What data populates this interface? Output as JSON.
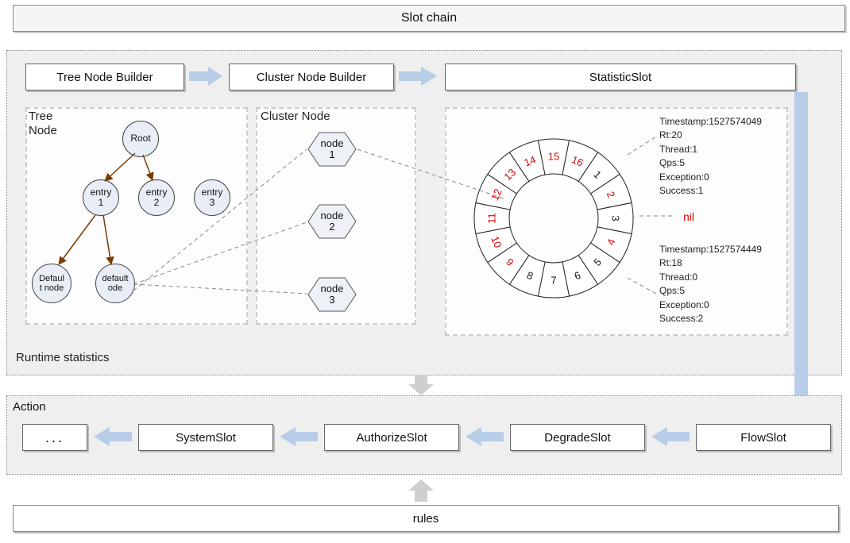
{
  "title": "Slot chain",
  "builders": {
    "tree": "Tree Node Builder",
    "cluster": "Cluster Node Builder",
    "stat": "StatisticSlot"
  },
  "tree": {
    "label_line1": "Tree",
    "label_line2": "Node",
    "root": "Root",
    "entry1_l1": "entry",
    "entry1_l2": "1",
    "entry2_l1": "entry",
    "entry2_l2": "2",
    "entry3_l1": "entry",
    "entry3_l2": "3",
    "defn1_l1": "Defaul",
    "defn1_l2": "t node",
    "defn2_l1": "default",
    "defn2_l2": "ode"
  },
  "cluster": {
    "label": "Cluster Node",
    "n1_l1": "node",
    "n1_l2": "1",
    "n2_l1": "node",
    "n2_l2": "2",
    "n3_l1": "node",
    "n3_l2": "3"
  },
  "ring": {
    "slots": [
      "1",
      "2",
      "3",
      "4",
      "5",
      "6",
      "7",
      "8",
      "9",
      "10",
      "11",
      "12",
      "13",
      "14",
      "15",
      "16"
    ],
    "red_slots": [
      2,
      4,
      9,
      10,
      11,
      12,
      13,
      14,
      15,
      16
    ],
    "nil": "nil"
  },
  "stats1": {
    "Timestamp": "1527574049",
    "Rt": "20",
    "Thread": "1",
    "Qps": "5",
    "Exception": "0",
    "Success": "1"
  },
  "stats2": {
    "Timestamp": "1527574449",
    "Rt": "18",
    "Thread": "0",
    "Qps": "5",
    "Exception": "0",
    "Success": "2"
  },
  "runtime": "Runtime statistics",
  "action": {
    "label": "Action",
    "slots": {
      "ellipsis": "...",
      "system": "SystemSlot",
      "authorize": "AuthorizeSlot",
      "degrade": "DegradeSlot",
      "flow": "FlowSlot"
    }
  },
  "rules": "rules"
}
